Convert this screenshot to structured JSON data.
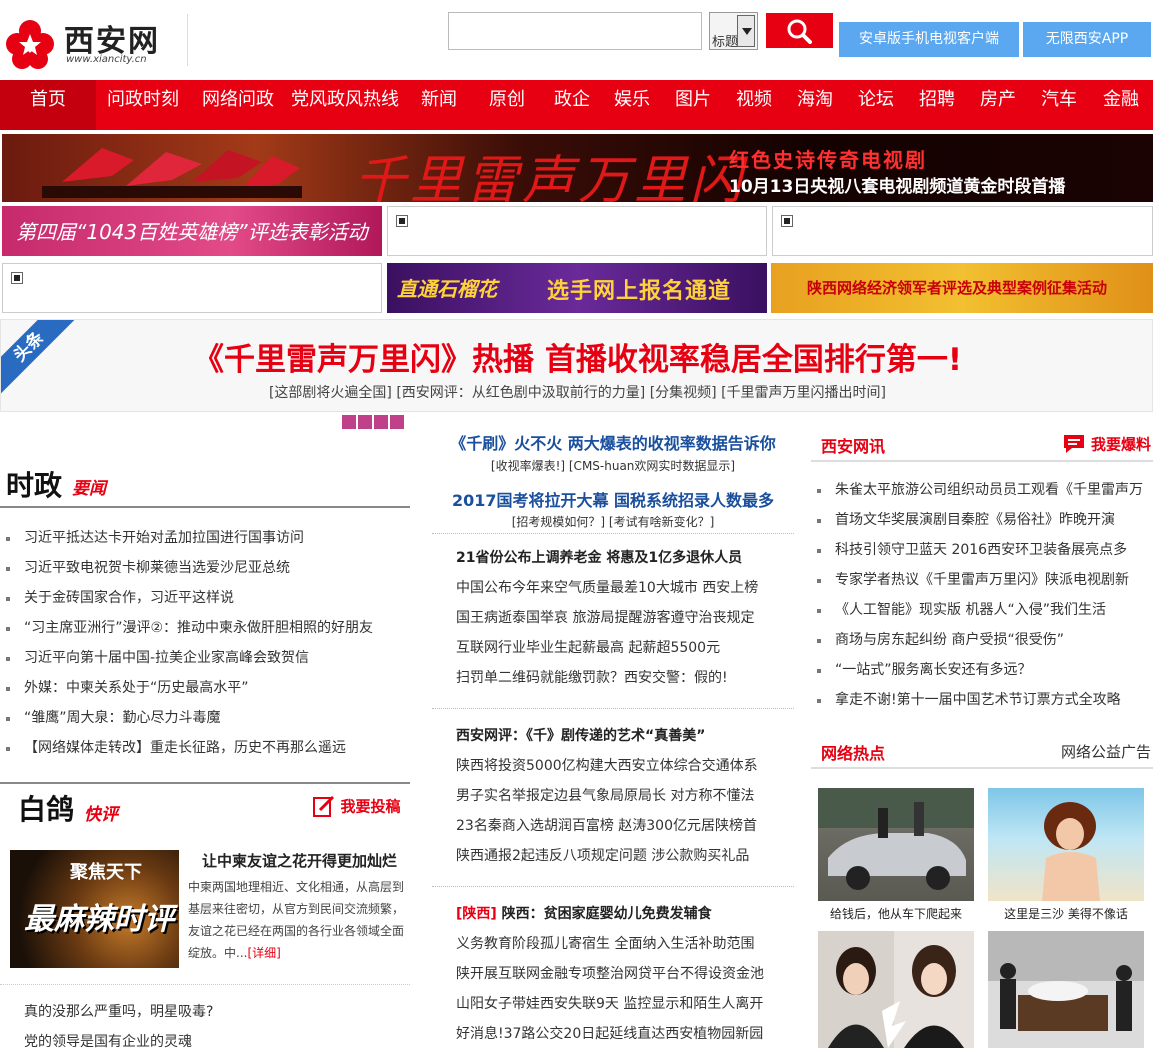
{
  "site": {
    "name": "西安网",
    "url": "www.xiancity.cn"
  },
  "search": {
    "select_value": "标题"
  },
  "app_buttons": [
    "安卓版手机电视客户端",
    "无限西安APP"
  ],
  "nav": [
    "首页",
    "问政时刻",
    "网络问政",
    "党风政风热线",
    "新闻",
    "原创",
    "政企",
    "娱乐",
    "图片",
    "视频",
    "海淘",
    "论坛",
    "招聘",
    "房产",
    "汽车",
    "金融"
  ],
  "banner": {
    "title": "千里雷声万里闪",
    "sub1": "红色史诗传奇电视剧",
    "sub2": "10月13日央视八套电视剧频道黄金时段首播"
  },
  "promos": {
    "p1": "第四届“1043百姓英雄榜”评选表彰活动",
    "p2_a": "直通石榴花",
    "p2_b": "选手网上报名通道",
    "p3": "陕西网络经济领军者评选及典型案例征集活动"
  },
  "headline": {
    "corner": "头条",
    "title": "《千里雷声万里闪》热播 首播收视率稳居全国排行第一!",
    "links": "[这部剧将火遍全国] [西安网评：从红色剧中汲取前行的力量] [分集视频] [千里雷声万里闪播出时间]"
  },
  "shizheng": {
    "title": "时政",
    "sub": "要闻",
    "items": [
      "习近平抵达达卡开始对孟加拉国进行国事访问",
      "习近平致电祝贺卡柳莱德当选爱沙尼亚总统",
      "关于金砖国家合作，习近平这样说",
      "“习主席亚洲行”漫评②：推动中柬永做肝胆相照的好朋友",
      "习近平向第十届中国-拉美企业家高峰会致贺信",
      "外媒：中柬关系处于“历史最高水平”",
      "“雏鹰”周大泉：勤心尽力斗毒魔",
      "【网络媒体走转改】重走长征路，历史不再那么遥远"
    ]
  },
  "baige": {
    "title": "白鸽",
    "sub": "快评",
    "contribute": "我要投稿",
    "img_line1": "聚焦天下",
    "img_line2": "最麻辣时评",
    "article_title": "让中柬友谊之花开得更加灿烂",
    "article_body": "中柬两国地理相近、文化相通，从高层到基层来往密切，从官方到民间交流频繁，友谊之花已经在两国的各行业各领域全面绽放。中...",
    "more": "[详细]",
    "items": [
      "真的没那么严重吗，明星吸毒?",
      "党的领导是国有企业的灵魂"
    ]
  },
  "middle": {
    "head1": "《千刷》火不火 两大爆表的收视率数据告诉你",
    "sub1": "[收视率爆表!] [CMS-huan欢网实时数据显示]",
    "head2": "2017国考将拉开大幕 国税系统招录人数最多",
    "sub2": "[招考规模如何？] [考试有啥新变化？]",
    "group1": [
      "21省份公布上调养老金  将惠及1亿多退休人员",
      "中国公布今年来空气质量最差10大城市  西安上榜",
      "国王病逝泰国举哀  旅游局提醒游客遵守治丧规定",
      "互联网行业毕业生起薪最高  起薪超5500元",
      "扫罚单二维码就能缴罚款？西安交警：假的!"
    ],
    "group2": [
      "西安网评：《千》剧传递的艺术“真善美”",
      "陕西将投资5000亿构建大西安立体综合交通体系",
      "男子实名举报定边县气象局原局长  对方称不懂法",
      "23名秦商入选胡润百富榜  赵涛300亿元居陕榜首",
      "陕西通报2起违反八项规定问题  涉公款购买礼品"
    ],
    "group3_tag": "[陕西]",
    "group3": [
      "陕西：贫困家庭婴幼儿免费发辅食",
      "义务教育阶段孤儿寄宿生  全面纳入生活补助范围",
      "陕开展互联网金融专项整治网贷平台不得设资金池",
      "山阳女子带娃西安失联9天  监控显示和陌生人离开",
      "好消息!37路公交20日起延线直达西安植物园新园"
    ]
  },
  "right": {
    "xunhead": "西安网讯",
    "baoliao": "我要爆料",
    "items": [
      "朱雀太平旅游公司组织动员员工观看《千里雷声万",
      "首场文华奖展演剧目秦腔《易俗社》昨晚开演",
      "科技引领守卫蓝天  2016西安环卫装备展亮点多",
      "专家学者热议《千里雷声万里闪》陕派电视剧新",
      "《人工智能》现实版  机器人“入侵”我们生活",
      "商场与房东起纠纷  商户受损“很受伤”",
      "“一站式”服务离长安还有多远？",
      "拿走不谢!第十一届中国艺术节订票方式全攻略"
    ],
    "hothead": "网络热点",
    "gongyi": "网络公益广告",
    "captions": [
      "给钱后，他从车下爬起来",
      "这里是三沙  美得不像话"
    ]
  },
  "colors": {
    "brand_red": "#e60012",
    "app_blue": "#5ba8f0",
    "link_blue": "#1a4f9e"
  }
}
